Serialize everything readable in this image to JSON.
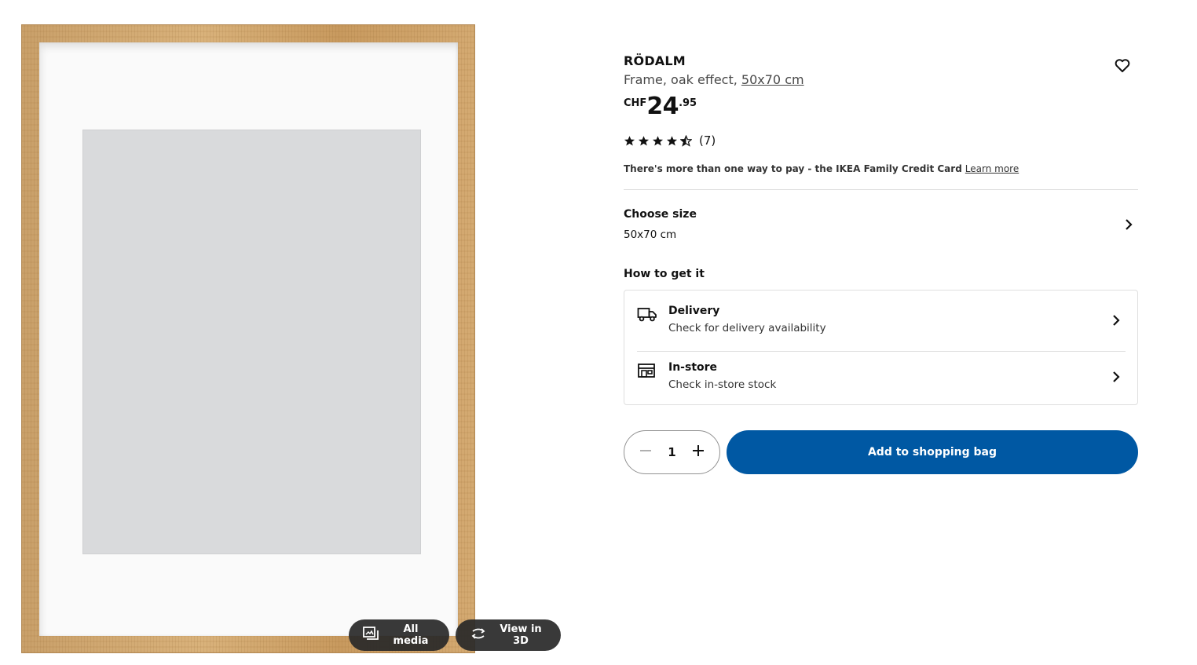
{
  "media": {
    "all_media_label": "All media",
    "view_3d_label": "View in 3D"
  },
  "product": {
    "name": "RÖDALM",
    "description": "Frame, oak effect, ",
    "size_link": "50x70 cm",
    "price": {
      "currency": "CHF",
      "integer": "24",
      "decimal": ".95"
    },
    "rating": {
      "stars": 4.5,
      "count_label": "(7)"
    },
    "credit_text": "There's more than one way to pay - the IKEA Family Credit Card",
    "credit_link": "Learn more"
  },
  "size": {
    "label": "Choose size",
    "value": "50x70 cm"
  },
  "how_to_get": {
    "heading": "How to get it",
    "delivery": {
      "title": "Delivery",
      "subtitle": "Check for delivery availability"
    },
    "instore": {
      "title": "In-store",
      "subtitle": "Check in-store stock"
    }
  },
  "purchase": {
    "quantity": "1",
    "add_label": "Add to shopping bag"
  },
  "colors": {
    "brand_blue": "#0058a3",
    "text": "#111111",
    "muted": "#484848",
    "divider": "#dfdfdf"
  },
  "icons": [
    "all-media-icon",
    "rotate-3d-icon",
    "heart-icon",
    "star-icon",
    "chevron-right-icon",
    "truck-icon",
    "store-icon",
    "minus-icon",
    "plus-icon"
  ]
}
